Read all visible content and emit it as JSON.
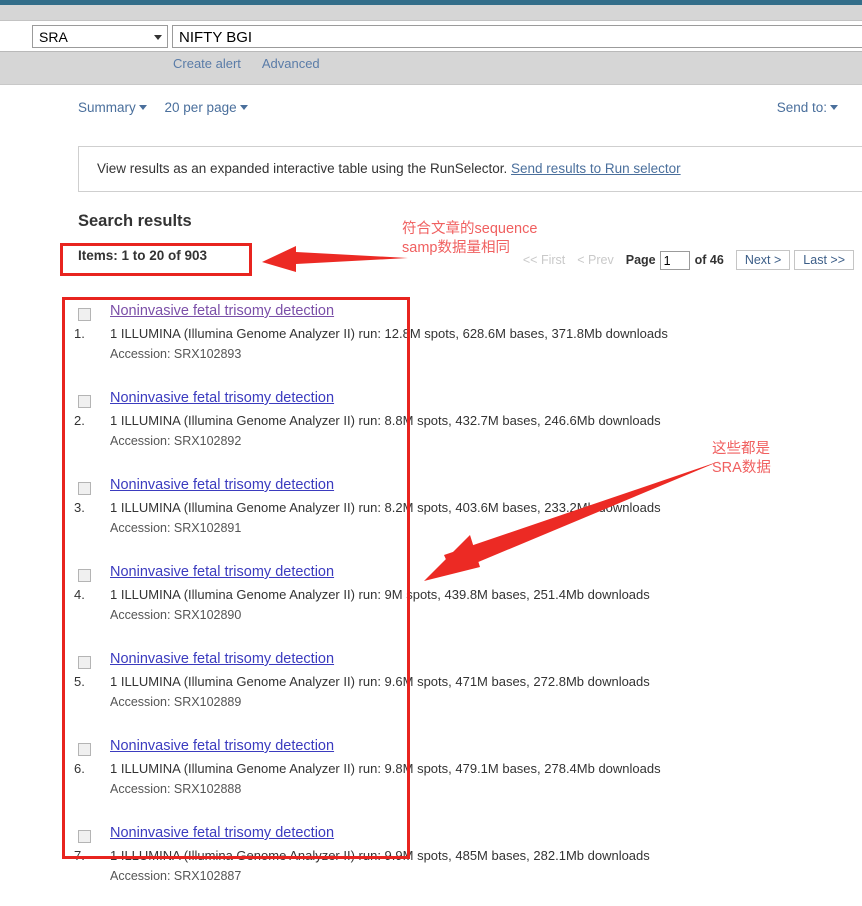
{
  "browser": {
    "database_select": "SRA",
    "search_value": "NIFTY BGI",
    "create_alert_label": "Create alert",
    "advanced_label": "Advanced"
  },
  "toolbar": {
    "display_format": "Summary",
    "per_page": "20 per page",
    "send_to": "Send to:"
  },
  "notice": {
    "text": "View results as an expanded interactive table using the RunSelector.",
    "link_label": "Send results to Run selector"
  },
  "results_header": {
    "title": "Search results",
    "items_count": "Items: 1 to 20 of 903"
  },
  "pagination": {
    "first_label": "<< First",
    "prev_label": "< Prev",
    "page_label": "Page",
    "page_value": "1",
    "of_label": "of 46",
    "next_label": "Next >",
    "last_label": "Last >>"
  },
  "results": [
    {
      "number": "1.",
      "title": "Noninvasive fetal trisomy detection",
      "visited": true,
      "description": "1 ILLUMINA (Illumina Genome Analyzer II) run: 12.8M spots, 628.6M bases, 371.8Mb downloads",
      "accession": "Accession: SRX102893"
    },
    {
      "number": "2.",
      "title": "Noninvasive fetal trisomy detection",
      "visited": false,
      "description": "1 ILLUMINA (Illumina Genome Analyzer II) run: 8.8M spots, 432.7M bases, 246.6Mb downloads",
      "accession": "Accession: SRX102892"
    },
    {
      "number": "3.",
      "title": "Noninvasive fetal trisomy detection",
      "visited": false,
      "description": "1 ILLUMINA (Illumina Genome Analyzer II) run: 8.2M spots, 403.6M bases, 233.2Mb downloads",
      "accession": "Accession: SRX102891"
    },
    {
      "number": "4.",
      "title": "Noninvasive fetal trisomy detection",
      "visited": false,
      "description": "1 ILLUMINA (Illumina Genome Analyzer II) run: 9M spots, 439.8M bases, 251.4Mb downloads",
      "accession": "Accession: SRX102890"
    },
    {
      "number": "5.",
      "title": "Noninvasive fetal trisomy detection",
      "visited": false,
      "description": "1 ILLUMINA (Illumina Genome Analyzer II) run: 9.6M spots, 471M bases, 272.8Mb downloads",
      "accession": "Accession: SRX102889"
    },
    {
      "number": "6.",
      "title": "Noninvasive fetal trisomy detection",
      "visited": false,
      "description": "1 ILLUMINA (Illumina Genome Analyzer II) run: 9.8M spots, 479.1M bases, 278.4Mb downloads",
      "accession": "Accession: SRX102888"
    },
    {
      "number": "7.",
      "title": "Noninvasive fetal trisomy detection",
      "visited": false,
      "description": "1 ILLUMINA (Illumina Genome Analyzer II) run: 9.9M spots, 485M bases, 282.1Mb downloads",
      "accession": "Accession: SRX102887"
    }
  ],
  "annotations": {
    "note_1_line_1": "符合文章的sequence",
    "note_1_line_2": "samp数据量相同",
    "note_2_line_1": "这些都是",
    "note_2_line_2": "SRA数据",
    "highlight_color": "#e8241f",
    "note_color": "#f06060"
  }
}
